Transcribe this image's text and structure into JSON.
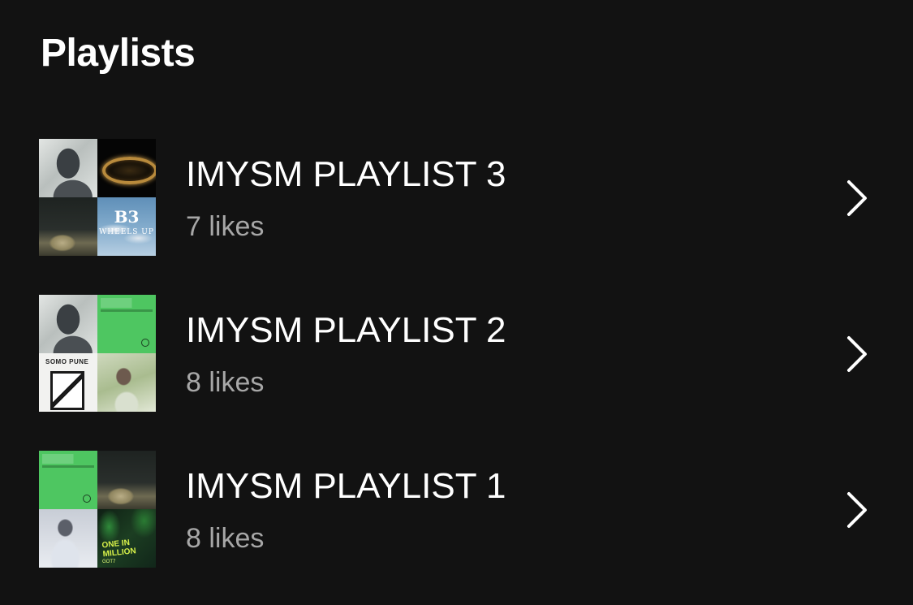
{
  "section": {
    "title": "Playlists"
  },
  "playlists": [
    {
      "title": "IMYSM PLAYLIST 3",
      "likes": "7 likes",
      "cover_tiles": [
        "portrait-grey",
        "gold-ring",
        "dark-room",
        "wheels-up"
      ],
      "cover_text": {
        "wheels_up_top": "B3",
        "wheels_up_bottom": "WHEELS UP"
      }
    },
    {
      "title": "IMYSM PLAYLIST 2",
      "likes": "8 likes",
      "cover_tiles": [
        "portrait-grey",
        "green-album",
        "bw-door",
        "garden-portrait"
      ],
      "cover_text": {
        "bw_door_top": "SOMO PUNE"
      }
    },
    {
      "title": "IMYSM PLAYLIST 1",
      "likes": "8 likes",
      "cover_tiles": [
        "green-album",
        "dark-room",
        "pale-figure",
        "one-million"
      ],
      "cover_text": {
        "one_million_top": "ONE IN MILLION",
        "one_million_bottom": "GOT7"
      }
    }
  ],
  "icons": {
    "row_action": "chevron-right-icon"
  },
  "colors": {
    "background": "#121212",
    "title_text": "#ffffff",
    "secondary_text": "#a7a7a7",
    "accent_green": "#4ec661"
  }
}
